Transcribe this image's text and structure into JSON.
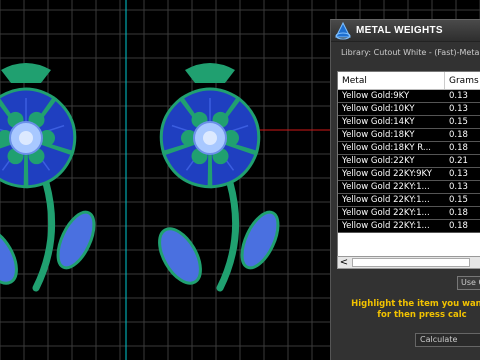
{
  "panel": {
    "title": "METAL WEIGHTS",
    "library_label": "Library: Cutout White - (Fast)-Metal",
    "columns": [
      "Metal",
      "Grams"
    ],
    "rows": [
      {
        "metal": "Yellow Gold:9KY",
        "grams": "0.13"
      },
      {
        "metal": "Yellow Gold:10KY",
        "grams": "0.13"
      },
      {
        "metal": "Yellow Gold:14KY",
        "grams": "0.15"
      },
      {
        "metal": "Yellow Gold:18KY",
        "grams": "0.18"
      },
      {
        "metal": "Yellow Gold:18KY R...",
        "grams": "0.18"
      },
      {
        "metal": "Yellow Gold:22KY",
        "grams": "0.21"
      },
      {
        "metal": "Yellow Gold 22KY:9KY",
        "grams": "0.13"
      },
      {
        "metal": "Yellow Gold 22KY:1...",
        "grams": "0.13"
      },
      {
        "metal": "Yellow Gold 22KY:1...",
        "grams": "0.15"
      },
      {
        "metal": "Yellow Gold 22KY:1...",
        "grams": "0.18"
      },
      {
        "metal": "Yellow Gold 22KY:1...",
        "grams": "0.18"
      }
    ],
    "use_button": "Use C",
    "hint_line1": "Highlight the item you want t",
    "hint_line2": "for then press calc",
    "calc_select": "Calculate",
    "scroll_left": "<"
  },
  "colors": {
    "viewport_bg": "#000000",
    "grid": "#3a3a3a",
    "axis_cyan": "#00c8d0",
    "axis_red": "#d01818",
    "gem_blue": "#1f3fc0",
    "metal_green": "#20a070",
    "hint_yellow": "#f2c200"
  },
  "icons": {
    "panel_logo": "ring-pyramid-icon"
  }
}
